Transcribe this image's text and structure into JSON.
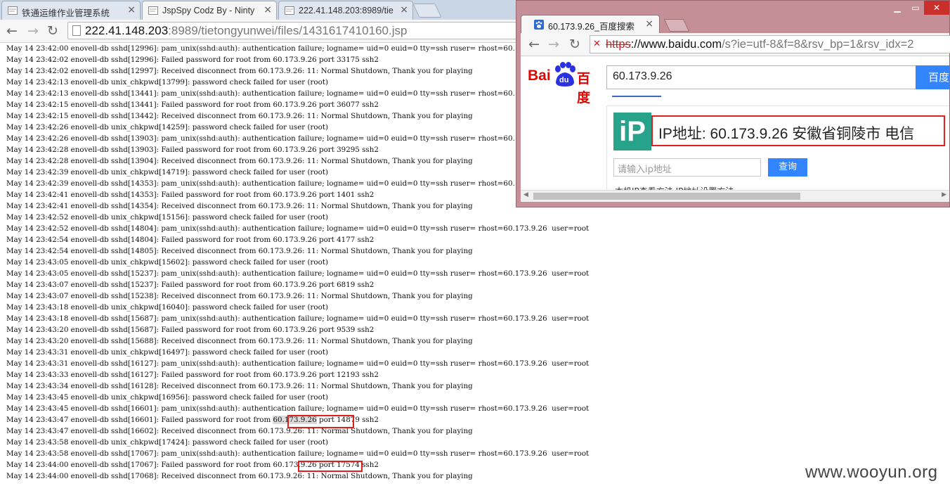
{
  "main_window": {
    "tabs": [
      {
        "title": "铁通运维作业管理系统",
        "active": false
      },
      {
        "title": "JspSpy Codz By - Ninty",
        "active": true
      },
      {
        "title": "222.41.148.203:8989/tie",
        "active": false
      }
    ],
    "address": {
      "host": "222.41.148.203",
      "path": ":8989/tietongyunwei/files/1431617410160.jsp"
    },
    "log_lines": [
      "May 14 23:42:00 enovell-db sshd[12996]: pam_unix(sshd:auth): authentication failure; logname= uid=0 euid=0 tty=ssh ruser= rhost=60.173.9.26  user=root",
      "May 14 23:42:02 enovell-db sshd[12996]: Failed password for root from 60.173.9.26 port 33175 ssh2",
      "May 14 23:42:02 enovell-db sshd[12997]: Received disconnect from 60.173.9.26: 11: Normal Shutdown, Thank you for playing",
      "May 14 23:42:13 enovell-db unix_chkpwd[13799]: password check failed for user (root)",
      "May 14 23:42:13 enovell-db sshd[13441]: pam_unix(sshd:auth): authentication failure; logname= uid=0 euid=0 tty=ssh ruser= rhost=60.173.9.26  user=root",
      "May 14 23:42:15 enovell-db sshd[13441]: Failed password for root from 60.173.9.26 port 36077 ssh2",
      "May 14 23:42:15 enovell-db sshd[13442]: Received disconnect from 60.173.9.26: 11: Normal Shutdown, Thank you for playing",
      "May 14 23:42:26 enovell-db unix_chkpwd[14259]: password check failed for user (root)",
      "May 14 23:42:26 enovell-db sshd[13903]: pam_unix(sshd:auth): authentication failure; logname= uid=0 euid=0 tty=ssh ruser= rhost=60.173.9.26  user=root",
      "May 14 23:42:28 enovell-db sshd[13903]: Failed password for root from 60.173.9.26 port 39295 ssh2",
      "May 14 23:42:28 enovell-db sshd[13904]: Received disconnect from 60.173.9.26: 11: Normal Shutdown, Thank you for playing",
      "May 14 23:42:39 enovell-db unix_chkpwd[14719]: password check failed for user (root)",
      "May 14 23:42:39 enovell-db sshd[14353]: pam_unix(sshd:auth): authentication failure; logname= uid=0 euid=0 tty=ssh ruser= rhost=60.173.9.26  user=root",
      "May 14 23:42:41 enovell-db sshd[14353]: Failed password for root from 60.173.9.26 port 1401 ssh2",
      "May 14 23:42:41 enovell-db sshd[14354]: Received disconnect from 60.173.9.26: 11: Normal Shutdown, Thank you for playing",
      "May 14 23:42:52 enovell-db unix_chkpwd[15156]: password check failed for user (root)",
      "May 14 23:42:52 enovell-db sshd[14804]: pam_unix(sshd:auth): authentication failure; logname= uid=0 euid=0 tty=ssh ruser= rhost=60.173.9.26  user=root",
      "May 14 23:42:54 enovell-db sshd[14804]: Failed password for root from 60.173.9.26 port 4177 ssh2",
      "May 14 23:42:54 enovell-db sshd[14805]: Received disconnect from 60.173.9.26: 11: Normal Shutdown, Thank you for playing",
      "May 14 23:43:05 enovell-db unix_chkpwd[15602]: password check failed for user (root)",
      "May 14 23:43:05 enovell-db sshd[15237]: pam_unix(sshd:auth): authentication failure; logname= uid=0 euid=0 tty=ssh ruser= rhost=60.173.9.26  user=root",
      "May 14 23:43:07 enovell-db sshd[15237]: Failed password for root from 60.173.9.26 port 6819 ssh2",
      "May 14 23:43:07 enovell-db sshd[15238]: Received disconnect from 60.173.9.26: 11: Normal Shutdown, Thank you for playing",
      "May 14 23:43:18 enovell-db unix_chkpwd[16040]: password check failed for user (root)",
      "May 14 23:43:18 enovell-db sshd[15687]: pam_unix(sshd:auth): authentication failure; logname= uid=0 euid=0 tty=ssh ruser= rhost=60.173.9.26  user=root",
      "May 14 23:43:20 enovell-db sshd[15687]: Failed password for root from 60.173.9.26 port 9539 ssh2",
      "May 14 23:43:20 enovell-db sshd[15688]: Received disconnect from 60.173.9.26: 11: Normal Shutdown, Thank you for playing",
      "May 14 23:43:31 enovell-db unix_chkpwd[16497]: password check failed for user (root)",
      "May 14 23:43:31 enovell-db sshd[16127]: pam_unix(sshd:auth): authentication failure; logname= uid=0 euid=0 tty=ssh ruser= rhost=60.173.9.26  user=root",
      "May 14 23:43:33 enovell-db sshd[16127]: Failed password for root from 60.173.9.26 port 12193 ssh2",
      "May 14 23:43:34 enovell-db sshd[16128]: Received disconnect from 60.173.9.26: 11: Normal Shutdown, Thank you for playing",
      "May 14 23:43:45 enovell-db unix_chkpwd[16956]: password check failed for user (root)",
      "May 14 23:43:45 enovell-db sshd[16601]: pam_unix(sshd:auth): authentication failure; logname= uid=0 euid=0 tty=ssh ruser= rhost=60.173.9.26  user=root",
      "May 14 23:43:47 enovell-db sshd[16601]: Failed password for root from 60.173.9.26 port 14879 ssh2",
      "May 14 23:43:47 enovell-db sshd[16602]: Received disconnect from 60.173.9.26: 11: Normal Shutdown, Thank you for playing",
      "May 14 23:43:58 enovell-db unix_chkpwd[17424]: password check failed for user (root)",
      "May 14 23:43:58 enovell-db sshd[17067]: pam_unix(sshd:auth): authentication failure; logname= uid=0 euid=0 tty=ssh ruser= rhost=60.173.9.26  user=root",
      "May 14 23:44:00 enovell-db sshd[17067]: Failed password for root from 60.173.9.26 port 17574 ssh2",
      "May 14 23:44:00 enovell-db sshd[17068]: Received disconnect from 60.173.9.26: 11: Normal Shutdown, Thank you for playing"
    ],
    "highlight_ip": "60.173.9.26"
  },
  "popup_window": {
    "tab_title": "60.173.9.26_百度搜索",
    "address": {
      "scheme": "https",
      "host": "://www.baidu.com",
      "path": "/s?ie=utf-8&f=8&rsv_bp=1&rsv_idx=2"
    },
    "logo": {
      "text_left": "Bai",
      "text_mid": "du",
      "text_right": "百度"
    },
    "search_query": "60.173.9.26",
    "search_button": "百度",
    "ip_icon_text": "iP",
    "ip_result": "IP地址: 60.173.9.26  安徽省铜陵市 电信",
    "ip_input_placeholder": "请输入ip地址",
    "ip_query_button": "查询",
    "cutoff_text": "本机IP查看方法    IP地址设置方法"
  },
  "watermark": "www.wooyun.org",
  "colors": {
    "highlight_red": "#e02020",
    "baidu_blue": "#3385ff",
    "baidu_red": "#e10601",
    "ip_green": "#27a38b"
  }
}
